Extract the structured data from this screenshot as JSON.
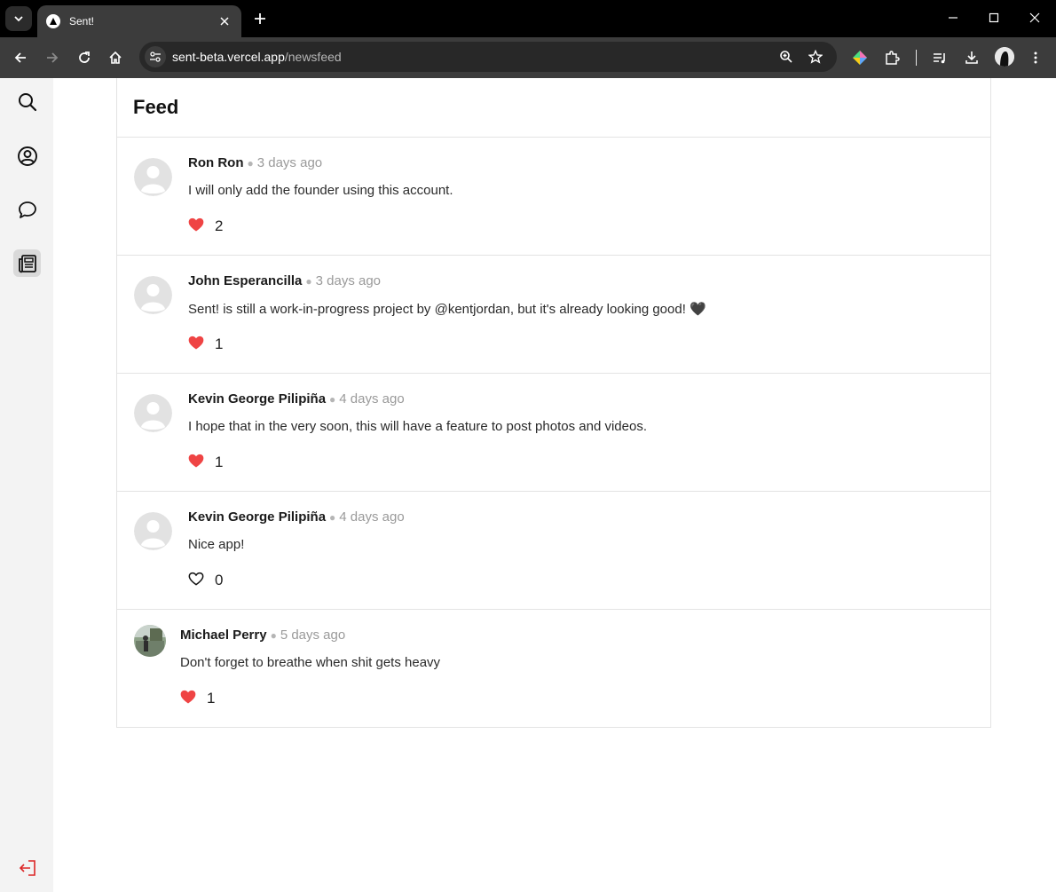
{
  "browser": {
    "tab_title": "Sent!",
    "url_host": "sent-beta.vercel.app",
    "url_path": "/newsfeed"
  },
  "feed": {
    "title": "Feed",
    "posts": [
      {
        "author": "Ron Ron",
        "time": "3 days ago",
        "text": "I will only add the founder using this account.",
        "likes": "2",
        "liked": true
      },
      {
        "author": "John Esperancilla",
        "time": "3 days ago",
        "text": "Sent! is still a work-in-progress project by @kentjordan, but it's already looking good! 🖤",
        "likes": "1",
        "liked": true
      },
      {
        "author": "Kevin George Pilipiña",
        "time": "4 days ago",
        "text": "I hope that in the very soon, this will have a feature to post photos and videos.",
        "likes": "1",
        "liked": true
      },
      {
        "author": "Kevin George Pilipiña",
        "time": "4 days ago",
        "text": "Nice app!",
        "likes": "0",
        "liked": false
      },
      {
        "author": "Michael Perry",
        "time": "5 days ago",
        "text": "Don't forget to breathe when shit gets heavy",
        "likes": "1",
        "liked": true
      }
    ]
  },
  "colors": {
    "like_red": "#ef4444",
    "logout_red": "#dc2626",
    "sidebar_bg": "#f3f3f3"
  },
  "icons": {
    "sidebar": [
      "search-icon",
      "profile-icon",
      "chat-icon",
      "newsfeed-icon"
    ],
    "logout": "logout-icon"
  }
}
